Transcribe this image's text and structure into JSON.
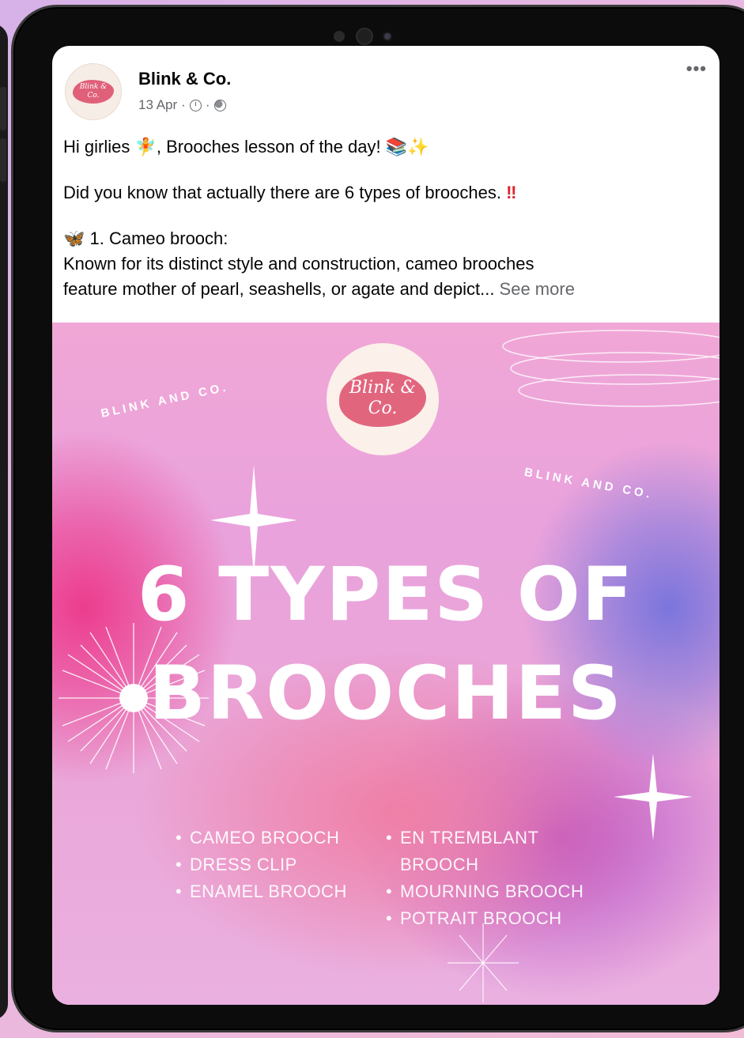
{
  "post": {
    "page_name": "Blink & Co.",
    "date": "13 Apr",
    "meta_sep": "·",
    "more_label": "•••",
    "avatar_text": "Blink & Co.",
    "text": {
      "line1_a": "Hi girlies ",
      "line1_fairy": "🧚",
      "line1_b": ", Brooches lesson of the day! ",
      "line1_books": "📚",
      "line1_sparkle": "✨",
      "line2": "Did you know that actually there are 6 types of brooches. ",
      "line2_bang": "‼",
      "item1_butterfly": "🦋",
      "item1_title": " 1. Cameo brooch:",
      "item1_body1": " Known for its distinct style and construction, cameo brooches",
      "item1_body2": "feature mother of pearl, seashells, or agate and depict...",
      "see_more": " See more"
    }
  },
  "image": {
    "logo_line1": "Blink &",
    "logo_line2": "Co.",
    "curved_left": "BLINK AND CO.",
    "curved_right": "BLINK AND CO.",
    "headline_line1": "6 TYPES OF",
    "headline_line2": "BROOCHES",
    "list_left": [
      "CAMEO BROOCH",
      "DRESS CLIP",
      "ENAMEL BROOCH"
    ],
    "list_right": [
      "EN TREMBLANT",
      "BROOCH",
      "MOURNING BROOCH",
      "POTRAIT BROOCH"
    ],
    "bullet": "•"
  }
}
